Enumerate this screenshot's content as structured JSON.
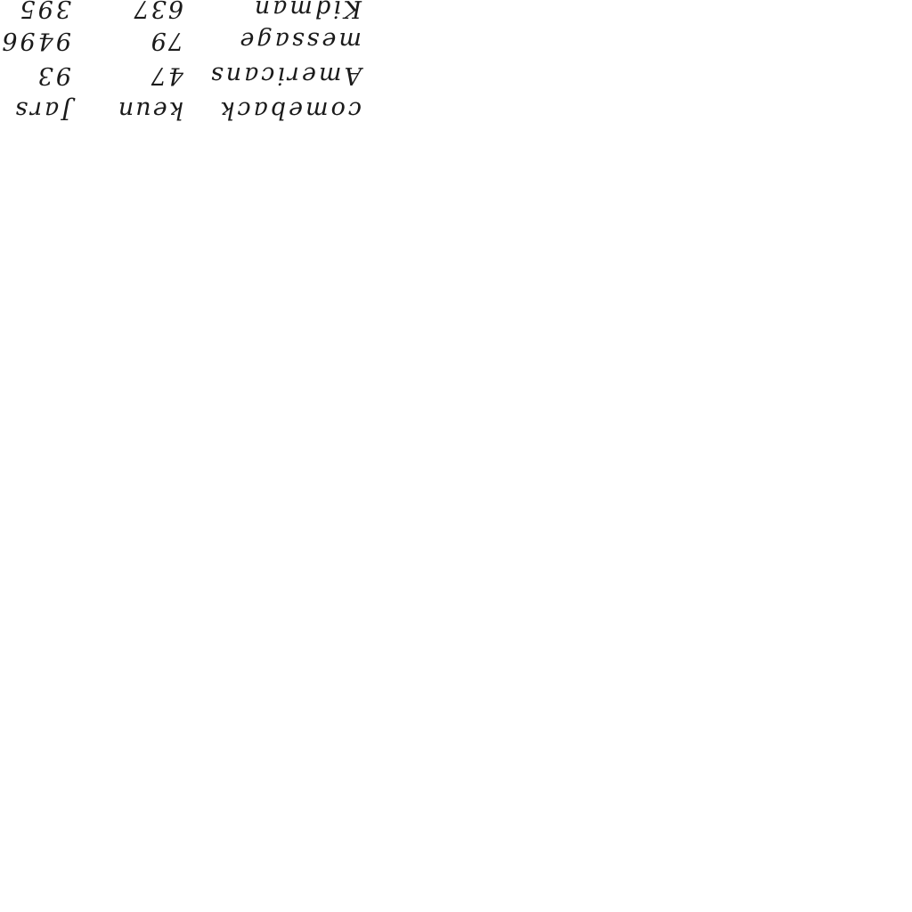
{
  "table": {
    "rows": [
      {
        "word": "comeback",
        "name": "keun",
        "value": "Jars"
      },
      {
        "word": "Americans",
        "name": "47",
        "value": "93"
      },
      {
        "word": "message",
        "name": "79",
        "value": "9496"
      },
      {
        "word": "Kidman",
        "name": "637",
        "value": "395"
      }
    ]
  }
}
